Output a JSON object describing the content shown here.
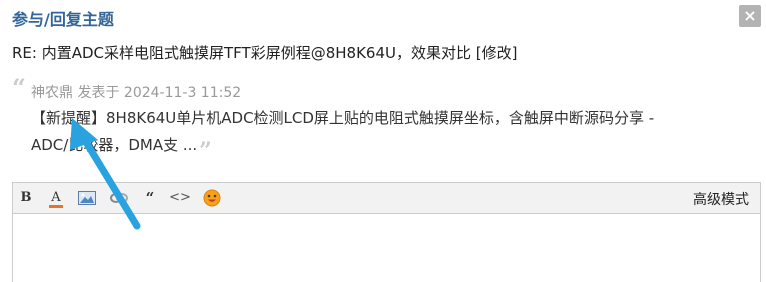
{
  "dialog": {
    "title": "参与/回复主题",
    "close_glyph": "×"
  },
  "subject": "RE: 内置ADC采样电阻式触摸屏TFT彩屏例程@8H8K64U，效果对比 [修改]",
  "quote": {
    "open_mark": "“",
    "author": "神农鼎",
    "posted_label": "发表于",
    "date": "2024-11-3 11:52",
    "line1": "【新提醒】8H8K64U单片机ADC检测LCD屏上贴的电阻式触摸屏坐标，含触屏中断源码分享 -",
    "line2": "ADC/比较器，DMA支 ...",
    "close_mark": "”"
  },
  "toolbar": {
    "bold_glyph": "B",
    "color_glyph": "A",
    "quote_glyph": "“",
    "code_glyph": "<>",
    "advanced_mode": "高级模式",
    "icons": [
      "bold-icon",
      "font-color-icon",
      "image-icon",
      "link-icon",
      "quote-icon",
      "code-icon",
      "smiley-icon"
    ]
  },
  "colors": {
    "title": "#336699",
    "close_bg": "#b3b3b3",
    "arrow": "#29a3e0",
    "font_color_bar": "#e8732c"
  }
}
